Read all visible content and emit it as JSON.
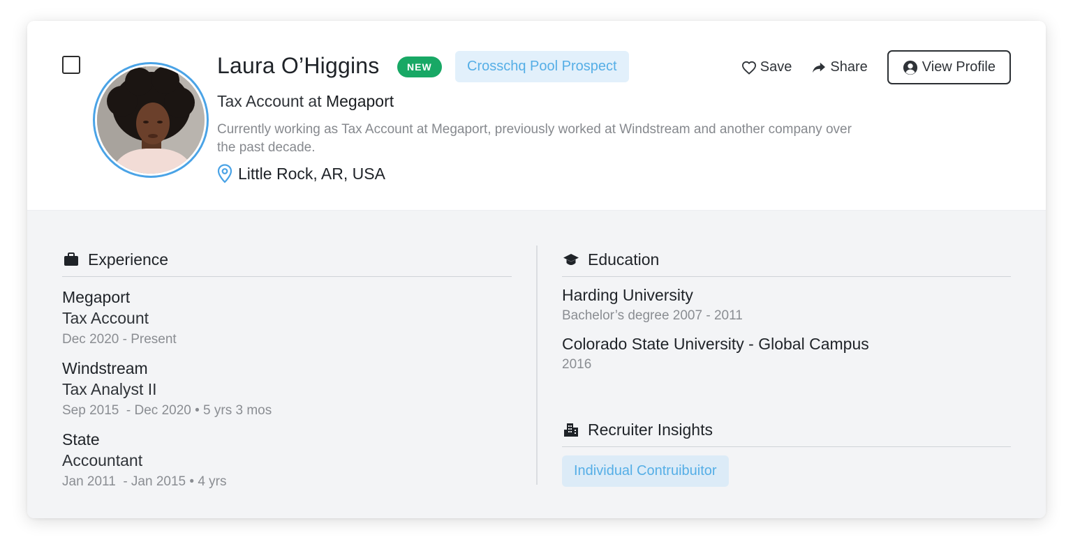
{
  "candidate": {
    "name": "Laura O’Higgins",
    "new_badge": "NEW",
    "pool_tag": "Crosschq Pool Prospect",
    "title_prefix": "Tax Account at",
    "title_company": "Megaport",
    "summary": "Currently working as Tax Account at Megaport, previously worked at Windstream and another company over the past decade.",
    "location": "Little Rock, AR, USA"
  },
  "actions": {
    "save": "Save",
    "share": "Share",
    "view_profile": "View Profile"
  },
  "experience": {
    "heading": "Experience",
    "items": [
      {
        "company": "Megaport",
        "role": "Tax Account",
        "dates": "Dec 2020 - Present"
      },
      {
        "company": "Windstream",
        "role": "Tax Analyst II",
        "dates": "Sep 2015  - Dec 2020 • 5 yrs 3 mos"
      },
      {
        "company": "State",
        "role": "Accountant",
        "dates": "Jan 2011  - Jan 2015 • 4 yrs"
      }
    ]
  },
  "education": {
    "heading": "Education",
    "items": [
      {
        "school": "Harding University",
        "detail": "Bachelor’s degree 2007 - 2011"
      },
      {
        "school": "Colorado State University - Global Campus",
        "detail": "2016"
      }
    ]
  },
  "insights": {
    "heading": "Recruiter Insights",
    "tag": "Individual Contruibuitor"
  },
  "colors": {
    "accent_blue": "#4aa3e6",
    "new_green": "#18a865",
    "tag_bg": "#e2f0fb",
    "tag_text": "#55aee6",
    "body_bg": "#f3f4f6"
  }
}
